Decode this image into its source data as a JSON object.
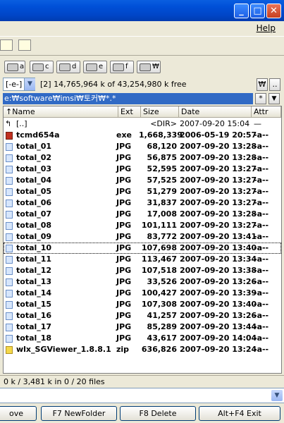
{
  "window": {
    "minimize_glyph": "_",
    "maximize_glyph": "□",
    "close_glyph": "✕"
  },
  "menu": {
    "help_label": "Help"
  },
  "drives": [
    {
      "label": "a"
    },
    {
      "label": "c"
    },
    {
      "label": "d"
    },
    {
      "label": "e"
    },
    {
      "label": "f"
    },
    {
      "label": "₩"
    }
  ],
  "drive_combo": {
    "value": "[-e-]",
    "arrow": "▼"
  },
  "free_info": "[2]  14,765,964 k of 43,254,980 k free",
  "root_button": "₩",
  "up_button": "..",
  "path": "e:₩software₩imsi₩토커₩*.*",
  "path_buttons": {
    "filter": "*",
    "history": "▼"
  },
  "columns": {
    "name": "↑Name",
    "ext": "Ext",
    "size": "Size",
    "date": "Date",
    "attr": "Attr"
  },
  "files": [
    {
      "name": "[..]",
      "ext": "",
      "size": "<DIR>",
      "date": "2007-09-20 15:04",
      "attr": "—",
      "icon": "up-icon"
    },
    {
      "name": "tcmd654a",
      "ext": "exe",
      "size": "1,668,339",
      "date": "2006-05-19 20:57",
      "attr": "-a--",
      "icon": "exe-icon"
    },
    {
      "name": "total_01",
      "ext": "JPG",
      "size": "68,120",
      "date": "2007-09-20 13:28",
      "attr": "-a--",
      "icon": "image-file-icon"
    },
    {
      "name": "total_02",
      "ext": "JPG",
      "size": "56,875",
      "date": "2007-09-20 13:28",
      "attr": "-a--",
      "icon": "image-file-icon"
    },
    {
      "name": "total_03",
      "ext": "JPG",
      "size": "52,595",
      "date": "2007-09-20 13:27",
      "attr": "-a--",
      "icon": "image-file-icon"
    },
    {
      "name": "total_04",
      "ext": "JPG",
      "size": "57,525",
      "date": "2007-09-20 13:27",
      "attr": "-a--",
      "icon": "image-file-icon"
    },
    {
      "name": "total_05",
      "ext": "JPG",
      "size": "51,279",
      "date": "2007-09-20 13:27",
      "attr": "-a--",
      "icon": "image-file-icon"
    },
    {
      "name": "total_06",
      "ext": "JPG",
      "size": "31,837",
      "date": "2007-09-20 13:27",
      "attr": "-a--",
      "icon": "image-file-icon"
    },
    {
      "name": "total_07",
      "ext": "JPG",
      "size": "17,008",
      "date": "2007-09-20 13:28",
      "attr": "-a--",
      "icon": "image-file-icon"
    },
    {
      "name": "total_08",
      "ext": "JPG",
      "size": "101,111",
      "date": "2007-09-20 13:27",
      "attr": "-a--",
      "icon": "image-file-icon"
    },
    {
      "name": "total_09",
      "ext": "JPG",
      "size": "83,772",
      "date": "2007-09-20 13:41",
      "attr": "-a--",
      "icon": "image-file-icon"
    },
    {
      "name": "total_10",
      "ext": "JPG",
      "size": "107,698",
      "date": "2007-09-20 13:40",
      "attr": "-a--",
      "icon": "image-file-icon",
      "focused": true
    },
    {
      "name": "total_11",
      "ext": "JPG",
      "size": "113,467",
      "date": "2007-09-20 13:34",
      "attr": "-a--",
      "icon": "image-file-icon"
    },
    {
      "name": "total_12",
      "ext": "JPG",
      "size": "107,518",
      "date": "2007-09-20 13:38",
      "attr": "-a--",
      "icon": "image-file-icon"
    },
    {
      "name": "total_13",
      "ext": "JPG",
      "size": "33,526",
      "date": "2007-09-20 13:26",
      "attr": "-a--",
      "icon": "image-file-icon"
    },
    {
      "name": "total_14",
      "ext": "JPG",
      "size": "100,427",
      "date": "2007-09-20 13:39",
      "attr": "-a--",
      "icon": "image-file-icon"
    },
    {
      "name": "total_15",
      "ext": "JPG",
      "size": "107,308",
      "date": "2007-09-20 13:40",
      "attr": "-a--",
      "icon": "image-file-icon"
    },
    {
      "name": "total_16",
      "ext": "JPG",
      "size": "41,257",
      "date": "2007-09-20 13:26",
      "attr": "-a--",
      "icon": "image-file-icon"
    },
    {
      "name": "total_17",
      "ext": "JPG",
      "size": "85,289",
      "date": "2007-09-20 13:44",
      "attr": "-a--",
      "icon": "image-file-icon"
    },
    {
      "name": "total_18",
      "ext": "JPG",
      "size": "43,617",
      "date": "2007-09-20 14:04",
      "attr": "-a--",
      "icon": "image-file-icon"
    },
    {
      "name": "wlx_SGViewer_1.8.8.1",
      "ext": "zip",
      "size": "636,826",
      "date": "2007-09-20 13:24",
      "attr": "-a--",
      "icon": "zip-icon"
    }
  ],
  "status": "0 k / 3,481 k in 0 / 20 files",
  "cmd_arrow": "▼",
  "fkeys": [
    {
      "label": "ove"
    },
    {
      "label": "F7 NewFolder"
    },
    {
      "label": "F8 Delete"
    },
    {
      "label": "Alt+F4 Exit"
    }
  ]
}
